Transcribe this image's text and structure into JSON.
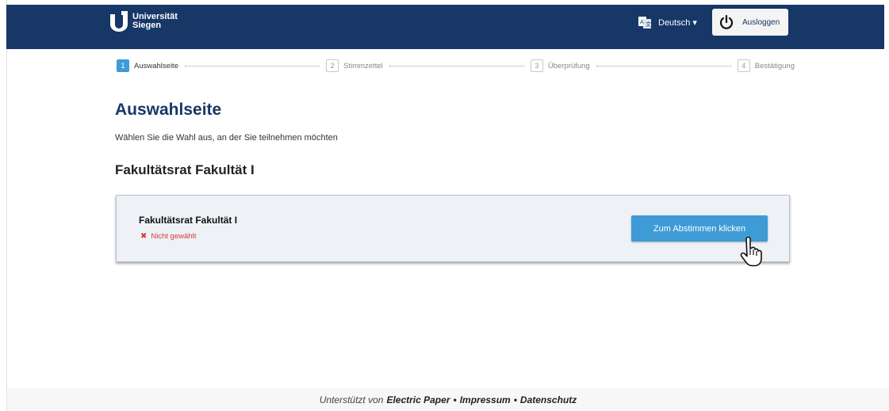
{
  "header": {
    "logo_line1": "Universität",
    "logo_line2": "Siegen",
    "language": "Deutsch ▾",
    "logout_label": "Ausloggen"
  },
  "stepper": [
    {
      "num": "1",
      "label": "Auswahlseite"
    },
    {
      "num": "2",
      "label": "Stimmzettel"
    },
    {
      "num": "3",
      "label": "Überprüfung"
    },
    {
      "num": "4",
      "label": "Bestätigung"
    }
  ],
  "main": {
    "title": "Auswahlseite",
    "subtitle": "Wählen Sie die Wahl aus, an der Sie teilnehmen möchten",
    "section_title": "Fakultätsrat Fakultät I",
    "card": {
      "title": "Fakultätsrat Fakultät I",
      "status": "Nicht gewählt",
      "button": "Zum Abstimmen klicken"
    }
  },
  "footer": {
    "prefix": "Unterstützt von",
    "brand": "Electric Paper",
    "sep1": "•",
    "impressum": "Impressum",
    "sep2": "•",
    "datenschutz": "Datenschutz"
  },
  "colors": {
    "header_bg": "#173767",
    "accent": "#3e9bd6",
    "status_red": "#d9383a"
  }
}
